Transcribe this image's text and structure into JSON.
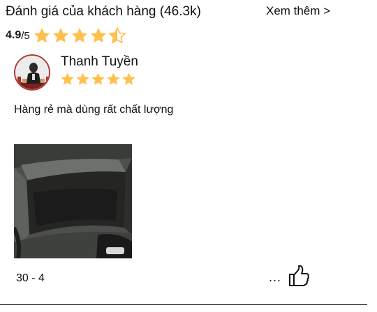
{
  "header": {
    "title": "Đánh giá của khách hàng (46.3k)",
    "see_more": "Xem thêm >"
  },
  "rating": {
    "score": "4.9",
    "max": "/5",
    "stars_value": 4.5,
    "star_color": "#FFC04D"
  },
  "review": {
    "author": "Thanh Tuyền",
    "stars_value": 5,
    "text": "Hàng rẻ mà dùng rất chất lượng",
    "date": "30 - 4",
    "more": "..."
  }
}
